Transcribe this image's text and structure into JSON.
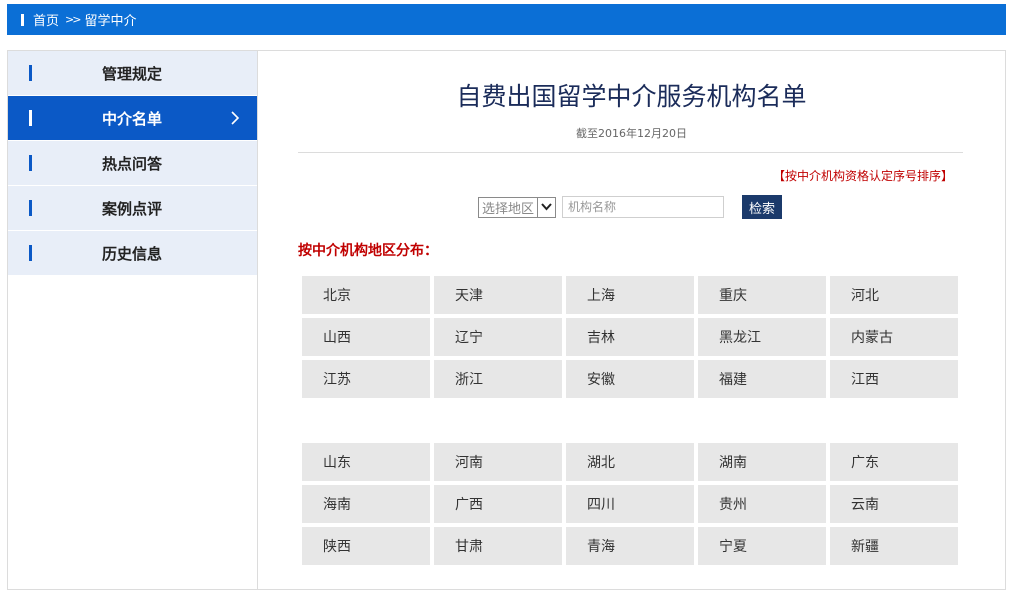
{
  "breadcrumb": {
    "home": "首页",
    "separator": ">>",
    "current": "留学中介"
  },
  "sidebar": {
    "items": [
      {
        "label": "管理规定"
      },
      {
        "label": "中介名单"
      },
      {
        "label": "热点问答"
      },
      {
        "label": "案例点评"
      },
      {
        "label": "历史信息"
      }
    ],
    "active_index": 1
  },
  "main": {
    "title": "自费出国留学中介服务机构名单",
    "date": "截至2016年12月20日",
    "sort_note": "【按中介机构资格认定序号排序】",
    "search": {
      "region_select_value": "选择地区",
      "name_placeholder": "机构名称",
      "button_label": "检索"
    },
    "region_heading": "按中介机构地区分布：",
    "region_groups": [
      [
        "北京",
        "天津",
        "上海",
        "重庆",
        "河北",
        "山西",
        "辽宁",
        "吉林",
        "黑龙江",
        "内蒙古",
        "江苏",
        "浙江",
        "安徽",
        "福建",
        "江西"
      ],
      [
        "山东",
        "河南",
        "湖北",
        "湖南",
        "广东",
        "海南",
        "广西",
        "四川",
        "贵州",
        "云南",
        "陕西",
        "甘肃",
        "青海",
        "宁夏",
        "新疆"
      ]
    ]
  },
  "colors": {
    "header_blue": "#0b6fd6",
    "active_blue": "#0b59c6",
    "accent_red": "#c00000",
    "title_navy": "#1b2c5a"
  }
}
